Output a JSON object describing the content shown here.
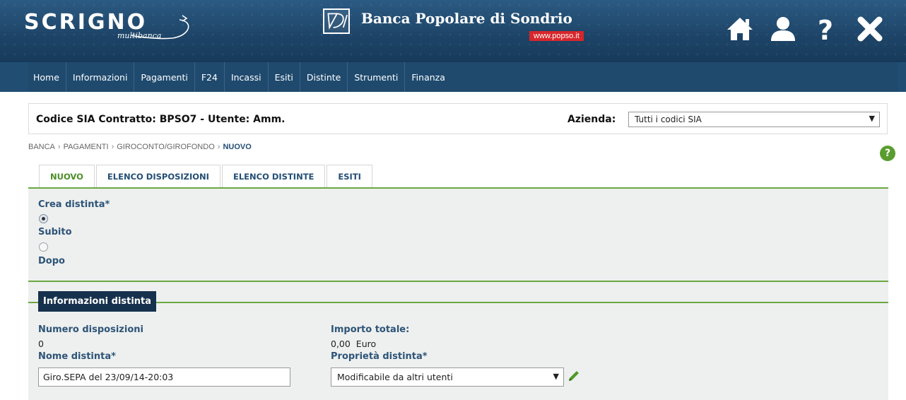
{
  "header": {
    "brand": "SCRIGNO",
    "brand_sub": "multibanca",
    "bank_name": "Banca Popolare di Sondrio",
    "bank_url": "www.popso.it",
    "icons": [
      "home-icon",
      "user-icon",
      "help-icon",
      "close-icon"
    ]
  },
  "nav": {
    "items": [
      {
        "label": "Home"
      },
      {
        "label": "Informazioni"
      },
      {
        "label": "Pagamenti"
      },
      {
        "label": "F24"
      },
      {
        "label": "Incassi"
      },
      {
        "label": "Esiti"
      },
      {
        "label": "Distinte"
      },
      {
        "label": "Strumenti"
      },
      {
        "label": "Finanza"
      }
    ]
  },
  "sia_bar": {
    "title": "Codice SIA Contratto: BPSO7 - Utente: Amm.",
    "azienda_label": "Azienda:",
    "azienda_value": "Tutti i codici SIA"
  },
  "breadcrumb": {
    "items": [
      "BANCA",
      "PAGAMENTI",
      "GIROCONTO/GIROFONDO"
    ],
    "separator": "›",
    "current": "NUOVO"
  },
  "tabs": [
    {
      "label": "NUOVO"
    },
    {
      "label": "ELENCO DISPOSIZIONI"
    },
    {
      "label": "ELENCO DISTINTE"
    },
    {
      "label": "ESITI"
    }
  ],
  "crea_distinta": {
    "label": "Crea distinta*",
    "options": [
      {
        "label": "Subito",
        "checked": true
      },
      {
        "label": "Dopo",
        "checked": false
      }
    ]
  },
  "info_distinta": {
    "title": "Informazioni distinta",
    "numero_label": "Numero disposizioni",
    "numero_value": "0",
    "importo_label": "Importo totale:",
    "importo_value": "0,00",
    "importo_currency": "Euro",
    "nome_label": "Nome distinta*",
    "nome_value": "Giro.SEPA del 23/09/14-20:03",
    "proprieta_label": "Proprietà distinta*",
    "proprieta_value": "Modificabile da altri utenti"
  }
}
